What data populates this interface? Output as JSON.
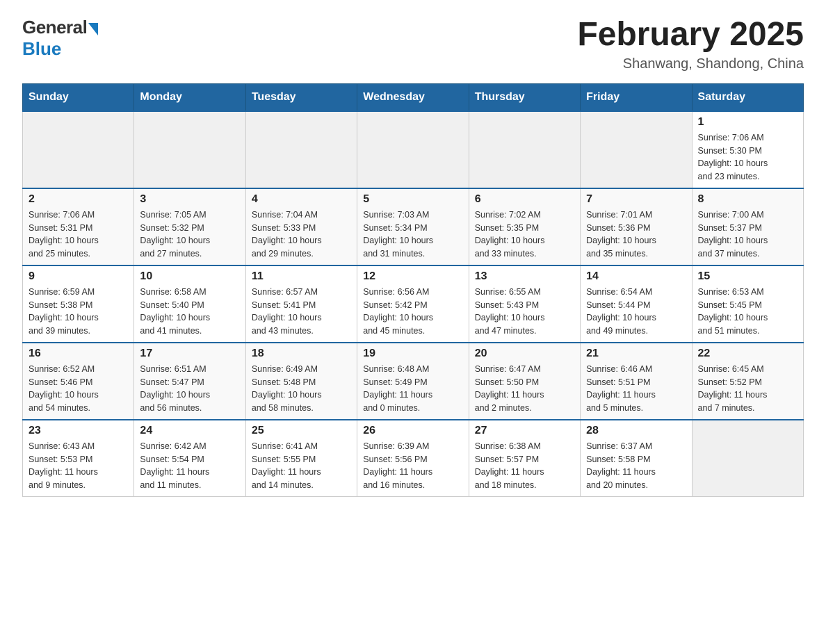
{
  "logo": {
    "general": "General",
    "blue": "Blue"
  },
  "title": "February 2025",
  "subtitle": "Shanwang, Shandong, China",
  "days_of_week": [
    "Sunday",
    "Monday",
    "Tuesday",
    "Wednesday",
    "Thursday",
    "Friday",
    "Saturday"
  ],
  "weeks": [
    [
      {
        "day": "",
        "info": ""
      },
      {
        "day": "",
        "info": ""
      },
      {
        "day": "",
        "info": ""
      },
      {
        "day": "",
        "info": ""
      },
      {
        "day": "",
        "info": ""
      },
      {
        "day": "",
        "info": ""
      },
      {
        "day": "1",
        "info": "Sunrise: 7:06 AM\nSunset: 5:30 PM\nDaylight: 10 hours\nand 23 minutes."
      }
    ],
    [
      {
        "day": "2",
        "info": "Sunrise: 7:06 AM\nSunset: 5:31 PM\nDaylight: 10 hours\nand 25 minutes."
      },
      {
        "day": "3",
        "info": "Sunrise: 7:05 AM\nSunset: 5:32 PM\nDaylight: 10 hours\nand 27 minutes."
      },
      {
        "day": "4",
        "info": "Sunrise: 7:04 AM\nSunset: 5:33 PM\nDaylight: 10 hours\nand 29 minutes."
      },
      {
        "day": "5",
        "info": "Sunrise: 7:03 AM\nSunset: 5:34 PM\nDaylight: 10 hours\nand 31 minutes."
      },
      {
        "day": "6",
        "info": "Sunrise: 7:02 AM\nSunset: 5:35 PM\nDaylight: 10 hours\nand 33 minutes."
      },
      {
        "day": "7",
        "info": "Sunrise: 7:01 AM\nSunset: 5:36 PM\nDaylight: 10 hours\nand 35 minutes."
      },
      {
        "day": "8",
        "info": "Sunrise: 7:00 AM\nSunset: 5:37 PM\nDaylight: 10 hours\nand 37 minutes."
      }
    ],
    [
      {
        "day": "9",
        "info": "Sunrise: 6:59 AM\nSunset: 5:38 PM\nDaylight: 10 hours\nand 39 minutes."
      },
      {
        "day": "10",
        "info": "Sunrise: 6:58 AM\nSunset: 5:40 PM\nDaylight: 10 hours\nand 41 minutes."
      },
      {
        "day": "11",
        "info": "Sunrise: 6:57 AM\nSunset: 5:41 PM\nDaylight: 10 hours\nand 43 minutes."
      },
      {
        "day": "12",
        "info": "Sunrise: 6:56 AM\nSunset: 5:42 PM\nDaylight: 10 hours\nand 45 minutes."
      },
      {
        "day": "13",
        "info": "Sunrise: 6:55 AM\nSunset: 5:43 PM\nDaylight: 10 hours\nand 47 minutes."
      },
      {
        "day": "14",
        "info": "Sunrise: 6:54 AM\nSunset: 5:44 PM\nDaylight: 10 hours\nand 49 minutes."
      },
      {
        "day": "15",
        "info": "Sunrise: 6:53 AM\nSunset: 5:45 PM\nDaylight: 10 hours\nand 51 minutes."
      }
    ],
    [
      {
        "day": "16",
        "info": "Sunrise: 6:52 AM\nSunset: 5:46 PM\nDaylight: 10 hours\nand 54 minutes."
      },
      {
        "day": "17",
        "info": "Sunrise: 6:51 AM\nSunset: 5:47 PM\nDaylight: 10 hours\nand 56 minutes."
      },
      {
        "day": "18",
        "info": "Sunrise: 6:49 AM\nSunset: 5:48 PM\nDaylight: 10 hours\nand 58 minutes."
      },
      {
        "day": "19",
        "info": "Sunrise: 6:48 AM\nSunset: 5:49 PM\nDaylight: 11 hours\nand 0 minutes."
      },
      {
        "day": "20",
        "info": "Sunrise: 6:47 AM\nSunset: 5:50 PM\nDaylight: 11 hours\nand 2 minutes."
      },
      {
        "day": "21",
        "info": "Sunrise: 6:46 AM\nSunset: 5:51 PM\nDaylight: 11 hours\nand 5 minutes."
      },
      {
        "day": "22",
        "info": "Sunrise: 6:45 AM\nSunset: 5:52 PM\nDaylight: 11 hours\nand 7 minutes."
      }
    ],
    [
      {
        "day": "23",
        "info": "Sunrise: 6:43 AM\nSunset: 5:53 PM\nDaylight: 11 hours\nand 9 minutes."
      },
      {
        "day": "24",
        "info": "Sunrise: 6:42 AM\nSunset: 5:54 PM\nDaylight: 11 hours\nand 11 minutes."
      },
      {
        "day": "25",
        "info": "Sunrise: 6:41 AM\nSunset: 5:55 PM\nDaylight: 11 hours\nand 14 minutes."
      },
      {
        "day": "26",
        "info": "Sunrise: 6:39 AM\nSunset: 5:56 PM\nDaylight: 11 hours\nand 16 minutes."
      },
      {
        "day": "27",
        "info": "Sunrise: 6:38 AM\nSunset: 5:57 PM\nDaylight: 11 hours\nand 18 minutes."
      },
      {
        "day": "28",
        "info": "Sunrise: 6:37 AM\nSunset: 5:58 PM\nDaylight: 11 hours\nand 20 minutes."
      },
      {
        "day": "",
        "info": ""
      }
    ]
  ]
}
